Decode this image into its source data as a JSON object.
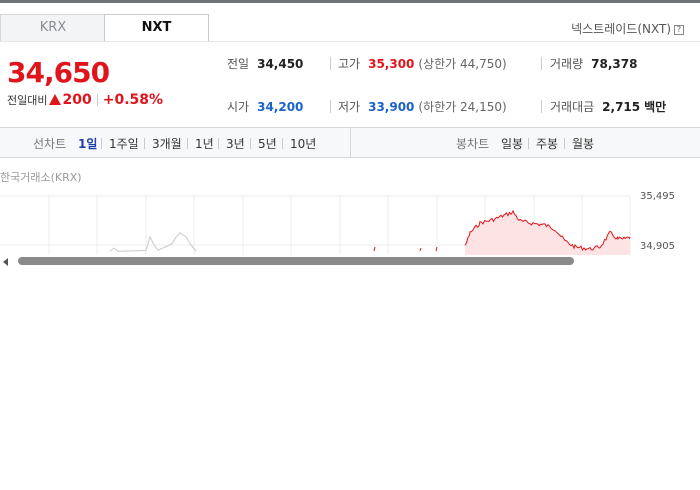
{
  "tabs": [
    {
      "label": "KRX",
      "active": false
    },
    {
      "label": "NXT",
      "active": true
    }
  ],
  "exchange_label": "넥스트레이드(NXT)",
  "help_icon_text": "?",
  "price": {
    "current": "34,650",
    "change_label": "전일대비",
    "change_amount": "200",
    "change_percent": "+0.58%"
  },
  "stats": {
    "prev_close": {
      "label": "전일",
      "value": "34,450"
    },
    "high": {
      "label": "고가",
      "value": "35,300",
      "sub": "(상한가 44,750)"
    },
    "volume": {
      "label": "거래량",
      "value": "78,378"
    },
    "open": {
      "label": "시가",
      "value": "34,200"
    },
    "low": {
      "label": "저가",
      "value": "33,900",
      "sub": "(하한가 24,150)"
    },
    "amount": {
      "label": "거래대금",
      "value": "2,715",
      "unit": "백만"
    }
  },
  "toolbar": {
    "line_chart_label": "선차트",
    "line_periods": [
      {
        "label": "1일",
        "active": true
      },
      {
        "label": "1주일",
        "active": false
      },
      {
        "label": "3개월",
        "active": false
      },
      {
        "label": "1년",
        "active": false
      },
      {
        "label": "3년",
        "active": false
      },
      {
        "label": "5년",
        "active": false
      },
      {
        "label": "10년",
        "active": false
      }
    ],
    "candle_chart_label": "봉차트",
    "candle_periods": [
      {
        "label": "일봉"
      },
      {
        "label": "주봉"
      },
      {
        "label": "월봉"
      }
    ]
  },
  "chart_caption": "한국거래소(KRX)",
  "chart_data": {
    "type": "area",
    "y_axis_ticks": [
      "35,495",
      "34,905"
    ],
    "colors": {
      "up": "#e0151c",
      "fill": "#fde3e3",
      "ghost": "#c9c9c9",
      "grid": "#ececec"
    }
  }
}
